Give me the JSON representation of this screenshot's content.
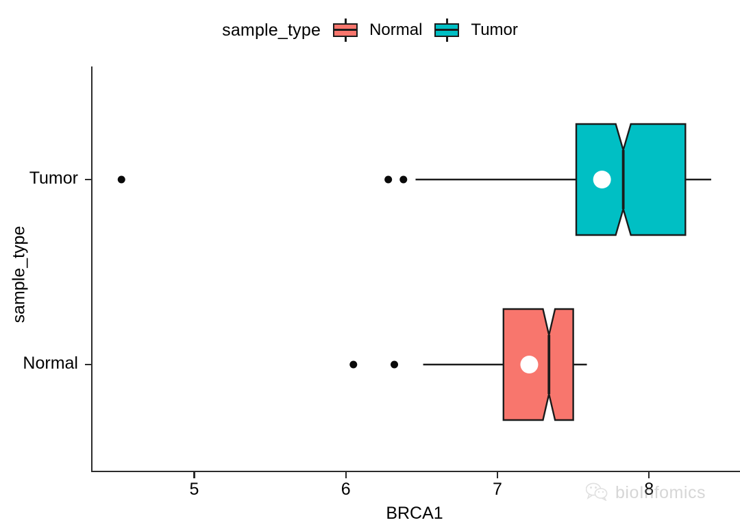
{
  "legend": {
    "title": "sample_type",
    "items": [
      {
        "label": "Normal",
        "color": "#F8766D"
      },
      {
        "label": "Tumor",
        "color": "#00BFC4"
      }
    ]
  },
  "axes": {
    "x_title": "BRCA1",
    "y_title": "sample_type",
    "x_ticks": [
      "5",
      "6",
      "7",
      "8"
    ],
    "y_ticks": [
      "Tumor",
      "Normal"
    ]
  },
  "watermark": {
    "text": "bioInfomics",
    "icon": "wechat-icon"
  },
  "chart_data": {
    "type": "box",
    "title": "",
    "xlabel": "BRCA1",
    "ylabel": "sample_type",
    "xlim": [
      4.32,
      8.6
    ],
    "xticks": [
      5,
      6,
      7,
      8
    ],
    "categories": [
      "Normal",
      "Tumor"
    ],
    "grid": false,
    "notched": true,
    "legend_position": "top",
    "legend_title": "sample_type",
    "series": [
      {
        "name": "Tumor",
        "color": "#00BFC4",
        "y_position": "Tumor",
        "whisker_low": 6.46,
        "q1": 7.52,
        "median": 7.83,
        "q3": 8.24,
        "whisker_high": 8.41,
        "mean": 7.69,
        "notch_low": 7.78,
        "notch_high": 7.88,
        "outliers": [
          4.52,
          6.28,
          6.38
        ]
      },
      {
        "name": "Normal",
        "color": "#F8766D",
        "y_position": "Normal",
        "whisker_low": 6.51,
        "q1": 7.04,
        "median": 7.34,
        "q3": 7.5,
        "whisker_high": 7.59,
        "mean": 7.21,
        "notch_low": 7.3,
        "notch_high": 7.38,
        "outliers": [
          6.05,
          6.32
        ]
      }
    ]
  }
}
